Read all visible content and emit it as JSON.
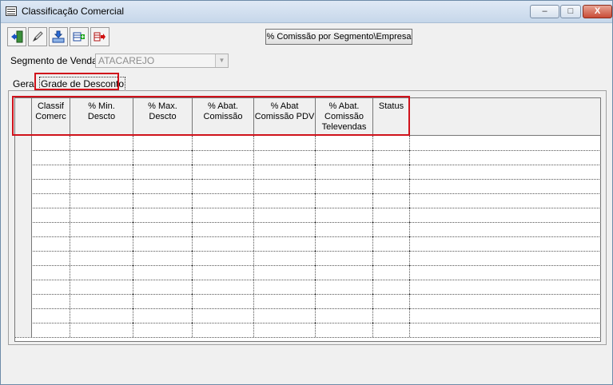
{
  "window": {
    "title": "Classificação Comercial",
    "min_glyph": "–",
    "max_glyph": "□",
    "close_glyph": "X"
  },
  "toolbar": {
    "buttons": [
      {
        "icon": "exit-door-icon"
      },
      {
        "icon": "pencil-icon"
      },
      {
        "icon": "save-tray-icon"
      },
      {
        "icon": "table-add-icon"
      },
      {
        "icon": "table-arrow-icon"
      }
    ],
    "commission_button_label": "% Comissão por Segmento\\Empresa"
  },
  "segment": {
    "label": "Segmento de Vendas",
    "value": "ATACAREJO"
  },
  "tabs": {
    "geral": "Geral",
    "grade": "Grade de Desconto"
  },
  "grid": {
    "columns": [
      {
        "label": "Classif\nComerc"
      },
      {
        "label": "% Min.\nDescto"
      },
      {
        "label": "% Max.\nDescto"
      },
      {
        "label": "% Abat.\nComissão"
      },
      {
        "label": "% Abat\nComissão PDV"
      },
      {
        "label": "% Abat.\nComissão\nTelevendas"
      },
      {
        "label": "Status"
      }
    ],
    "row_count": 14
  },
  "colors": {
    "highlight": "#d0121b",
    "window_bg": "#f0f0f0"
  }
}
